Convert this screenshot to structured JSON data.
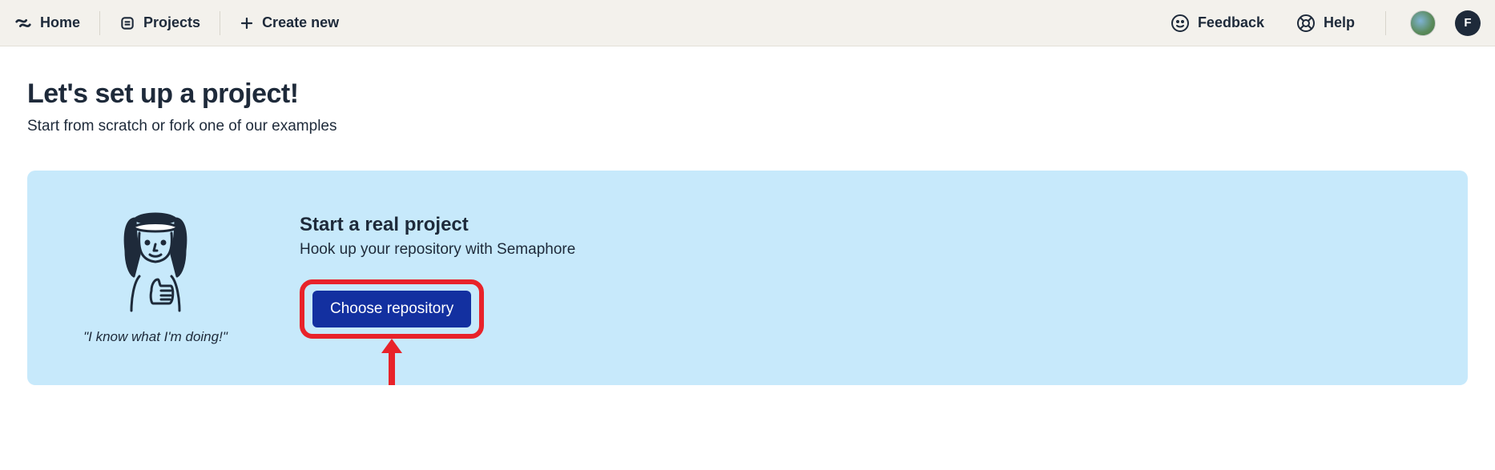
{
  "nav": {
    "home": "Home",
    "projects": "Projects",
    "create_new": "Create new",
    "feedback": "Feedback",
    "help": "Help",
    "avatar_letter": "F"
  },
  "page": {
    "title": "Let's set up a project!",
    "subtitle": "Start from scratch or fork one of our examples"
  },
  "card": {
    "caption": "\"I know what I'm doing!\"",
    "heading": "Start a real project",
    "description": "Hook up your repository with Semaphore",
    "button_label": "Choose repository"
  }
}
